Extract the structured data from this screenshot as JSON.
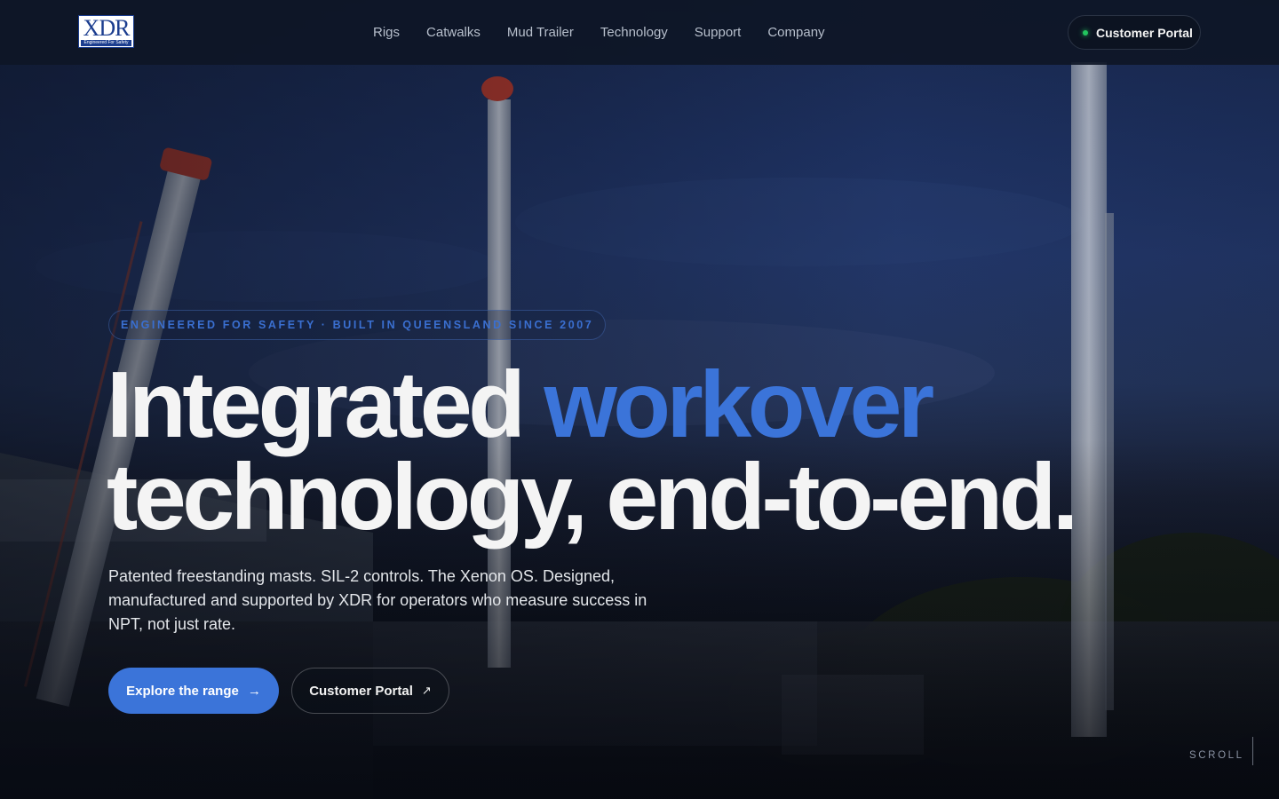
{
  "brand": {
    "logo_text": "XDR",
    "logo_tagline": "Engineered For Safety"
  },
  "nav": {
    "links": [
      "Rigs",
      "Catwalks",
      "Mud Trailer",
      "Technology",
      "Support",
      "Company"
    ],
    "portal_label": "Customer Portal",
    "portal_status_color": "#22c55e"
  },
  "hero": {
    "eyebrow": "ENGINEERED FOR SAFETY · BUILT IN QUEENSLAND SINCE 2007",
    "headline_part1": "Integrated ",
    "headline_accent": "workover",
    "headline_part2": "technology, end-to-end.",
    "subcopy": "Patented freestanding masts. SIL-2 controls. The Xenon OS. Designed, manufactured and supported by XDR for operators who measure success in NPT, not just rate.",
    "primary_cta": "Explore the range",
    "primary_cta_icon": "arrow-right-icon",
    "primary_cta_arrow": "→",
    "secondary_cta": "Customer Portal",
    "secondary_cta_icon": "external-link-icon",
    "secondary_cta_arrow": "↗",
    "scroll_label": "SCROLL"
  },
  "colors": {
    "accent": "#3b74d9",
    "nav_bg": "#0e1626",
    "text": "#f4f4f4"
  }
}
